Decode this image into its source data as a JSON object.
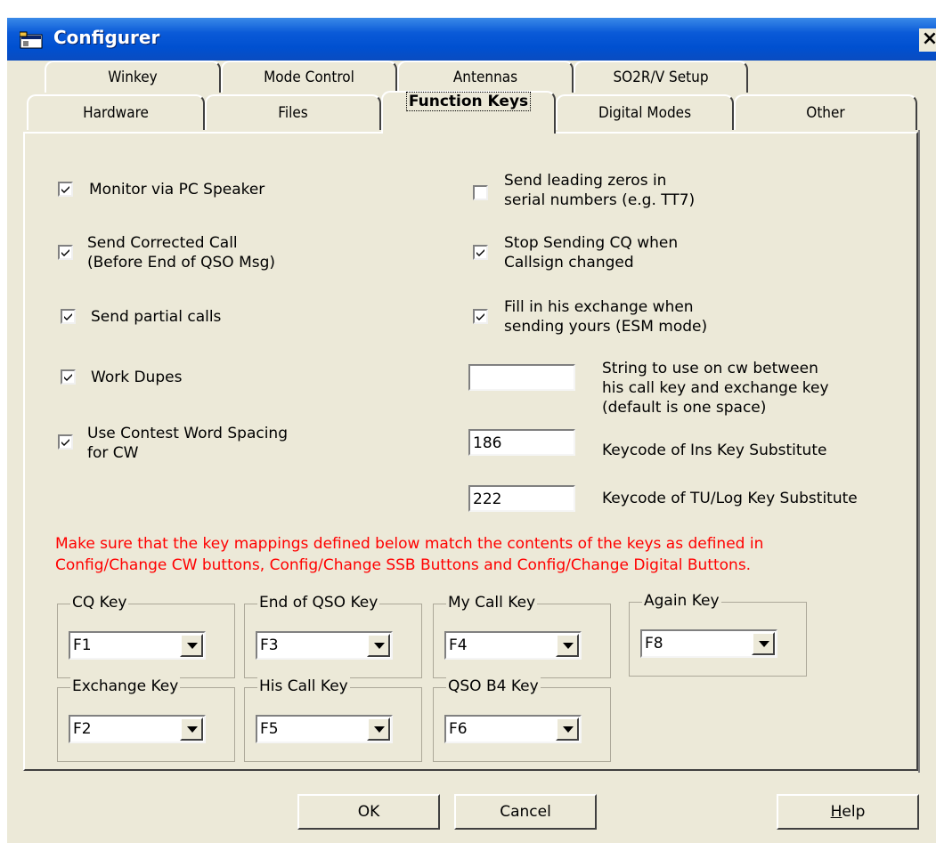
{
  "window": {
    "title": "Configurer",
    "close_glyph": "×",
    "app_icon": "app-icon"
  },
  "tabs_row1": [
    {
      "label": "Winkey"
    },
    {
      "label": "Mode Control"
    },
    {
      "label": "Antennas"
    },
    {
      "label": "SO2R/V Setup"
    }
  ],
  "tabs_row2": [
    {
      "label": "Hardware"
    },
    {
      "label": "Files"
    },
    {
      "label": "Function Keys",
      "active": true
    },
    {
      "label": "Digital Modes"
    },
    {
      "label": "Other"
    }
  ],
  "left_checks": [
    {
      "lines": [
        "Monitor via PC Speaker"
      ],
      "checked": true
    },
    {
      "lines": [
        "Send Corrected Call",
        "(Before End of QSO Msg)"
      ],
      "checked": true
    },
    {
      "lines": [
        "Send partial calls"
      ],
      "checked": true
    },
    {
      "lines": [
        "Work Dupes"
      ],
      "checked": true
    },
    {
      "lines": [
        "Use Contest Word Spacing",
        "for CW"
      ],
      "checked": true
    }
  ],
  "right_checks": [
    {
      "lines": [
        "Send leading zeros in",
        "serial numbers (e.g. TT7)"
      ],
      "checked": false
    },
    {
      "lines": [
        "Stop Sending CQ when",
        "Callsign changed"
      ],
      "checked": true
    },
    {
      "lines": [
        "Fill in his exchange when",
        "sending yours (ESM mode)"
      ],
      "checked": true
    }
  ],
  "string_field": {
    "value": "",
    "lines": [
      "String to use on cw between",
      "his call key and exchange key",
      "(default is one space)"
    ]
  },
  "ins_keycode": {
    "value": "186",
    "label": "Keycode of Ins Key Substitute"
  },
  "tu_keycode": {
    "value": "222",
    "label": "Keycode of TU/Log Key Substitute"
  },
  "warning": {
    "lines": [
      "Make sure that the key mappings defined below match the contents of the keys as defined in",
      "Config/Change CW buttons, Config/Change SSB Buttons and Config/Change Digital Buttons."
    ],
    "color": "#ff0000"
  },
  "key_groups": [
    {
      "title": "CQ Key",
      "value": "F1"
    },
    {
      "title": "End of QSO Key",
      "value": "F3"
    },
    {
      "title": "My Call Key",
      "value": "F4"
    },
    {
      "title": "Again  Key",
      "value": "F8"
    },
    {
      "title": "Exchange  Key",
      "value": "F2"
    },
    {
      "title": "His Call Key",
      "value": "F5"
    },
    {
      "title": "QSO B4 Key",
      "value": "F6"
    }
  ],
  "buttons": {
    "ok": "OK",
    "cancel": "Cancel",
    "help_mnemonic": "H",
    "help_rest": "elp"
  },
  "colors": {
    "title_bar": "#0a5ad8",
    "dialog_bg": "#ece9d8",
    "warning": "#ff0000"
  }
}
